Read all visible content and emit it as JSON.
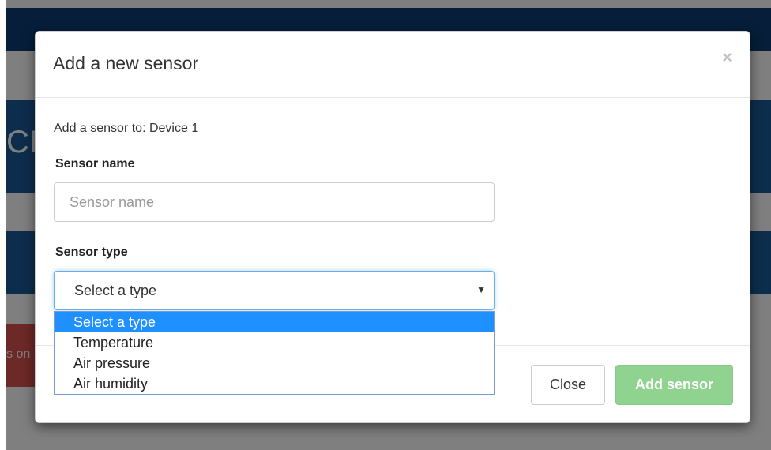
{
  "background": {
    "banner_text": "CE",
    "alert_text": "s on"
  },
  "modal": {
    "title": "Add a new sensor",
    "close_glyph": "×",
    "intro_text": "Add a sensor to: Device 1",
    "sensor_name": {
      "label": "Sensor name",
      "value": "",
      "placeholder": "Sensor name"
    },
    "sensor_type": {
      "label": "Sensor type",
      "selected": "Select a type",
      "arrow_glyph": "▼",
      "options": [
        "Select a type",
        "Temperature",
        "Air pressure",
        "Air humidity"
      ]
    },
    "footer": {
      "close_label": "Close",
      "add_label": "Add sensor"
    }
  },
  "colors": {
    "nav": "#0d3d73",
    "banner": "#1b5a9a",
    "alert": "#d9534f",
    "option_highlight": "#1e90ff",
    "add_button": "#90d390",
    "focus_border": "#66afe9"
  }
}
